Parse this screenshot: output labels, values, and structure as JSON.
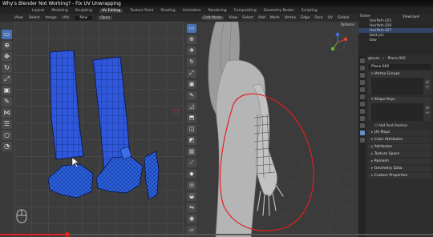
{
  "video": {
    "title": "Why's Blender Not Working? - Fix UV Unwrapping",
    "progress_fraction": 0.155
  },
  "workspaces": {
    "tabs": [
      "Layout",
      "Modeling",
      "Sculpting",
      "UV Editing",
      "Texture Paint",
      "Shading",
      "Animation",
      "Rendering",
      "Compositing",
      "Geometry Nodes",
      "Scripting"
    ],
    "active": "UV Editing"
  },
  "uv_editor": {
    "menus": [
      "View",
      "Select",
      "Image",
      "UVs"
    ],
    "image_field": "New",
    "open_label": "Open",
    "tools": [
      "select-box-icon",
      "cursor-icon",
      "move-icon",
      "rotate-icon",
      "scale-icon",
      "transform-icon",
      "annotate-icon",
      "rip-icon",
      "grab-icon",
      "relax-icon",
      "pinch-icon"
    ],
    "cursor_icon": "mouse-icon"
  },
  "viewport": {
    "mode": "Edit Mode",
    "menus": [
      "View",
      "Select",
      "Add",
      "Mesh",
      "Vertex",
      "Edge",
      "Face",
      "UV"
    ],
    "transform": "Global",
    "options": "Options",
    "annotation_color": "#e02020"
  },
  "outliner": {
    "view_layer": "ViewLayer",
    "scene": "Scene",
    "rows": [
      "HairPath.025",
      "HairPath.026",
      "HairPath.027",
      "back pin",
      "bow"
    ]
  },
  "properties": {
    "breadcrumb_object": "gloves",
    "breadcrumb_mesh": "Plane.002",
    "mesh_name": "Plane.002",
    "panels": {
      "vertex_groups": "Vertex Groups",
      "shape_keys": "Shape Keys",
      "add_rest_position": "Add Rest Position",
      "uv_maps": "UV Maps",
      "color_attributes": "Color Attributes",
      "attributes": "Attributes",
      "texture_space": "Texture Space",
      "remesh": "Remesh",
      "geometry_data": "Geometry Data",
      "custom_properties": "Custom Properties"
    }
  }
}
